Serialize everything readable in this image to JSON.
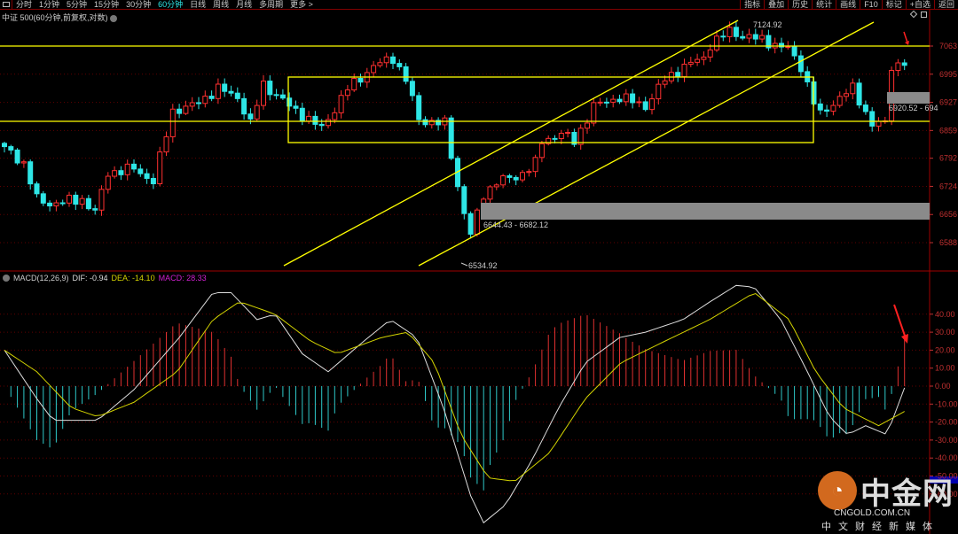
{
  "toolbar": {
    "tabs": [
      "分时",
      "1分钟",
      "5分钟",
      "15分钟",
      "30分钟",
      "60分钟",
      "日线",
      "周线",
      "月线",
      "多周期",
      "更多 >"
    ],
    "active": "60分钟",
    "right": [
      "指标",
      "叠加",
      "历史",
      "统计",
      "画线",
      "F10",
      "标记",
      "+自选",
      "返回"
    ]
  },
  "title": "中证 500(60分钟,前复权,对数)",
  "macd": {
    "name": "MACD(12,26,9)",
    "dif": "DIF: -0.94",
    "dea": "DEA: -14.10",
    "macd": "MACD: 28.33"
  },
  "annotations": {
    "high": "7124.92",
    "low": "6534.92",
    "zone1": "6644.43 - 6682.12",
    "zone2": "6920.52 - 694"
  },
  "colors": {
    "up": "#ff3030",
    "down": "#2ee6e6",
    "dif": "#dddddd",
    "dea": "#d4d400",
    "drawing": "#ffff00",
    "axis": "#c03030"
  },
  "watermark": {
    "logo": "中金网",
    "domain": "CNGOLD.COM.CN",
    "tagline": "中文财经新媒体"
  },
  "chart_data": [
    {
      "type": "candlestick",
      "title": "中证 500 60分钟",
      "y_ticks": [
        7063,
        6995,
        6927,
        6859,
        6792,
        6724,
        6656,
        6588
      ],
      "close_keypoints": [
        [
          0,
          6820
        ],
        [
          3,
          6779
        ],
        [
          5,
          6693
        ],
        [
          7,
          6682
        ],
        [
          12,
          6693
        ],
        [
          14,
          6661
        ],
        [
          16,
          6757
        ],
        [
          20,
          6767
        ],
        [
          23,
          6736
        ],
        [
          26,
          6907
        ],
        [
          29,
          6918
        ],
        [
          33,
          6960
        ],
        [
          36,
          6940
        ],
        [
          38,
          6875
        ],
        [
          40,
          6971
        ],
        [
          44,
          6918
        ],
        [
          49,
          6864
        ],
        [
          53,
          6960
        ],
        [
          57,
          7014
        ],
        [
          60,
          7035
        ],
        [
          62,
          6982
        ],
        [
          64,
          6885
        ],
        [
          68,
          6875
        ],
        [
          70,
          6725
        ],
        [
          71,
          6661
        ],
        [
          72,
          6607
        ],
        [
          74,
          6704
        ],
        [
          76,
          6736
        ],
        [
          79,
          6746
        ],
        [
          82,
          6779
        ],
        [
          83,
          6832
        ],
        [
          86,
          6853
        ],
        [
          88,
          6832
        ],
        [
          91,
          6918
        ],
        [
          95,
          6940
        ],
        [
          99,
          6918
        ],
        [
          102,
          6982
        ],
        [
          105,
          7014
        ],
        [
          108,
          7035
        ],
        [
          109,
          7067
        ],
        [
          112,
          7099
        ],
        [
          114,
          7088
        ],
        [
          117,
          7078
        ],
        [
          121,
          7056
        ],
        [
          123,
          7014
        ],
        [
          125,
          6928
        ],
        [
          126,
          6896
        ],
        [
          129,
          6940
        ],
        [
          131,
          6960
        ],
        [
          134,
          6875
        ],
        [
          136,
          6875
        ],
        [
          137,
          7014
        ],
        [
          139,
          7025
        ]
      ],
      "bars": 140
    },
    {
      "type": "line",
      "title": "MACD(12,26,9)",
      "y_ticks": [
        40,
        30,
        20,
        10,
        0,
        -10,
        -20,
        -30,
        -40,
        -50,
        -60
      ],
      "dif_keypoints": [
        [
          0,
          20
        ],
        [
          5,
          -7
        ],
        [
          7.5,
          -19
        ],
        [
          14.4,
          -19
        ],
        [
          20,
          -2
        ],
        [
          27,
          27
        ],
        [
          32.2,
          52
        ],
        [
          35,
          52
        ],
        [
          39,
          37
        ],
        [
          41.8,
          40
        ],
        [
          46,
          18
        ],
        [
          50,
          8
        ],
        [
          55.5,
          25
        ],
        [
          59.6,
          37
        ],
        [
          63.7,
          27
        ],
        [
          67.8,
          -12
        ],
        [
          72,
          -61
        ],
        [
          74,
          -76
        ],
        [
          77.4,
          -66
        ],
        [
          81.5,
          -41
        ],
        [
          85.6,
          -12
        ],
        [
          89.7,
          13
        ],
        [
          95,
          27
        ],
        [
          99,
          30
        ],
        [
          104.8,
          37
        ],
        [
          109,
          47
        ],
        [
          113,
          56
        ],
        [
          115.8,
          55
        ],
        [
          119.9,
          37
        ],
        [
          124,
          8
        ],
        [
          127.4,
          -17
        ],
        [
          130.2,
          -27
        ],
        [
          133,
          -22
        ],
        [
          136.3,
          -27
        ],
        [
          139,
          -0.94
        ]
      ],
      "dea_keypoints": [
        [
          0,
          20
        ],
        [
          5,
          8
        ],
        [
          10.3,
          -12
        ],
        [
          14.4,
          -17
        ],
        [
          20,
          -9
        ],
        [
          26.7,
          8
        ],
        [
          32.2,
          37
        ],
        [
          36.3,
          47
        ],
        [
          41.8,
          40
        ],
        [
          47.3,
          25
        ],
        [
          51.4,
          18
        ],
        [
          58.2,
          27
        ],
        [
          62.3,
          30
        ],
        [
          66.4,
          13
        ],
        [
          70.5,
          -27
        ],
        [
          74.7,
          -51
        ],
        [
          78.8,
          -53
        ],
        [
          84.2,
          -37
        ],
        [
          89.7,
          -7
        ],
        [
          95.2,
          13
        ],
        [
          102,
          25
        ],
        [
          108.9,
          37
        ],
        [
          115.8,
          52
        ],
        [
          121.2,
          37
        ],
        [
          125.3,
          8
        ],
        [
          129.5,
          -12
        ],
        [
          135,
          -22
        ],
        [
          139,
          -14.1
        ]
      ]
    }
  ]
}
